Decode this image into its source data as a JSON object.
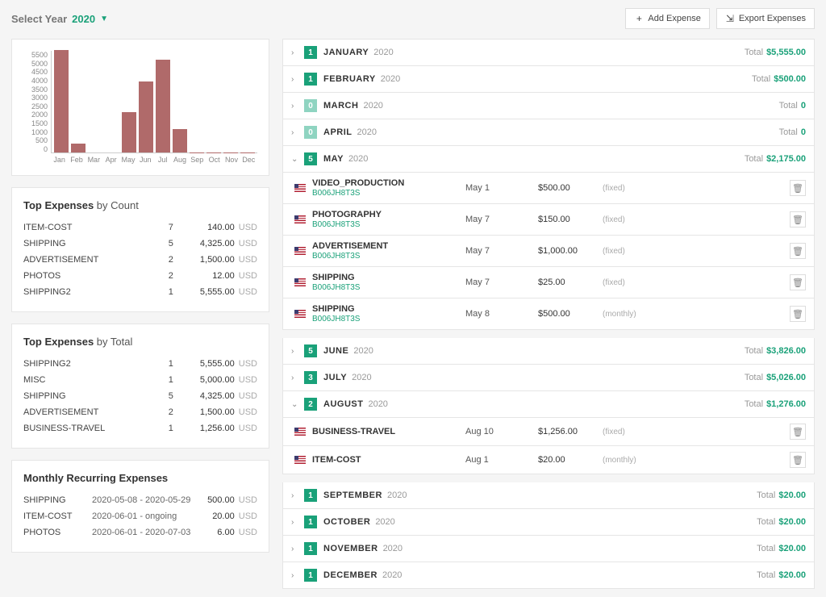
{
  "header": {
    "select_year_label": "Select Year",
    "year_value": "2020",
    "add_expense": "Add Expense",
    "export_expenses": "Export Expenses"
  },
  "chart_data": {
    "type": "bar",
    "categories": [
      "Jan",
      "Feb",
      "Mar",
      "Apr",
      "May",
      "Jun",
      "Jul",
      "Aug",
      "Sep",
      "Oct",
      "Nov",
      "Dec"
    ],
    "values": [
      5555,
      500,
      0,
      0,
      2175,
      3826,
      5026,
      1276,
      20,
      20,
      20,
      20
    ],
    "y_ticks": [
      "5500",
      "5000",
      "4500",
      "4000",
      "3500",
      "3000",
      "2500",
      "2000",
      "1500",
      "1000",
      "500",
      "0"
    ],
    "ylim": [
      0,
      5500
    ]
  },
  "top_by_count": {
    "title_bold": "Top Expenses",
    "title_thin": " by Count",
    "currency": "USD",
    "rows": [
      {
        "name": "ITEM-COST",
        "count": "7",
        "amount": "140.00"
      },
      {
        "name": "SHIPPING",
        "count": "5",
        "amount": "4,325.00"
      },
      {
        "name": "ADVERTISEMENT",
        "count": "2",
        "amount": "1,500.00"
      },
      {
        "name": "PHOTOS",
        "count": "2",
        "amount": "12.00"
      },
      {
        "name": "SHIPPING2",
        "count": "1",
        "amount": "5,555.00"
      }
    ]
  },
  "top_by_total": {
    "title_bold": "Top Expenses",
    "title_thin": " by Total",
    "currency": "USD",
    "rows": [
      {
        "name": "SHIPPING2",
        "count": "1",
        "amount": "5,555.00"
      },
      {
        "name": "MISC",
        "count": "1",
        "amount": "5,000.00"
      },
      {
        "name": "SHIPPING",
        "count": "5",
        "amount": "4,325.00"
      },
      {
        "name": "ADVERTISEMENT",
        "count": "2",
        "amount": "1,500.00"
      },
      {
        "name": "BUSINESS-TRAVEL",
        "count": "1",
        "amount": "1,256.00"
      }
    ]
  },
  "recurring": {
    "title": "Monthly Recurring Expenses",
    "currency": "USD",
    "rows": [
      {
        "name": "SHIPPING",
        "range": "2020-05-08 - 2020-05-29",
        "amount": "500.00"
      },
      {
        "name": "ITEM-COST",
        "range": "2020-06-01 - ongoing",
        "amount": "20.00"
      },
      {
        "name": "PHOTOS",
        "range": "2020-06-01 - 2020-07-03",
        "amount": "6.00"
      }
    ]
  },
  "months": [
    {
      "badge": "1",
      "name": "JANUARY",
      "year": "2020",
      "total": "$5,555.00",
      "expanded": false,
      "zero": false
    },
    {
      "badge": "1",
      "name": "FEBRUARY",
      "year": "2020",
      "total": "$500.00",
      "expanded": false,
      "zero": false
    },
    {
      "badge": "0",
      "name": "MARCH",
      "year": "2020",
      "total": "0",
      "expanded": false,
      "zero": true
    },
    {
      "badge": "0",
      "name": "APRIL",
      "year": "2020",
      "total": "0",
      "expanded": false,
      "zero": true
    },
    {
      "badge": "5",
      "name": "MAY",
      "year": "2020",
      "total": "$2,175.00",
      "expanded": true,
      "zero": false,
      "items": [
        {
          "name": "VIDEO_PRODUCTION",
          "sub": "B006JH8T3S",
          "date": "May 1",
          "amount": "$500.00",
          "freq": "(fixed)"
        },
        {
          "name": "PHOTOGRAPHY",
          "sub": "B006JH8T3S",
          "date": "May 7",
          "amount": "$150.00",
          "freq": "(fixed)"
        },
        {
          "name": "ADVERTISEMENT",
          "sub": "B006JH8T3S",
          "date": "May 7",
          "amount": "$1,000.00",
          "freq": "(fixed)"
        },
        {
          "name": "SHIPPING",
          "sub": "B006JH8T3S",
          "date": "May 7",
          "amount": "$25.00",
          "freq": "(fixed)"
        },
        {
          "name": "SHIPPING",
          "sub": "B006JH8T3S",
          "date": "May 8",
          "amount": "$500.00",
          "freq": "(monthly)"
        }
      ]
    },
    {
      "badge": "5",
      "name": "JUNE",
      "year": "2020",
      "total": "$3,826.00",
      "expanded": false,
      "zero": false
    },
    {
      "badge": "3",
      "name": "JULY",
      "year": "2020",
      "total": "$5,026.00",
      "expanded": false,
      "zero": false
    },
    {
      "badge": "2",
      "name": "AUGUST",
      "year": "2020",
      "total": "$1,276.00",
      "expanded": true,
      "zero": false,
      "items": [
        {
          "name": "BUSINESS-TRAVEL",
          "sub": "",
          "date": "Aug 10",
          "amount": "$1,256.00",
          "freq": "(fixed)"
        },
        {
          "name": "ITEM-COST",
          "sub": "",
          "date": "Aug 1",
          "amount": "$20.00",
          "freq": "(monthly)"
        }
      ]
    },
    {
      "badge": "1",
      "name": "SEPTEMBER",
      "year": "2020",
      "total": "$20.00",
      "expanded": false,
      "zero": false
    },
    {
      "badge": "1",
      "name": "OCTOBER",
      "year": "2020",
      "total": "$20.00",
      "expanded": false,
      "zero": false
    },
    {
      "badge": "1",
      "name": "NOVEMBER",
      "year": "2020",
      "total": "$20.00",
      "expanded": false,
      "zero": false
    },
    {
      "badge": "1",
      "name": "DECEMBER",
      "year": "2020",
      "total": "$20.00",
      "expanded": false,
      "zero": false
    }
  ],
  "label_total": "Total"
}
